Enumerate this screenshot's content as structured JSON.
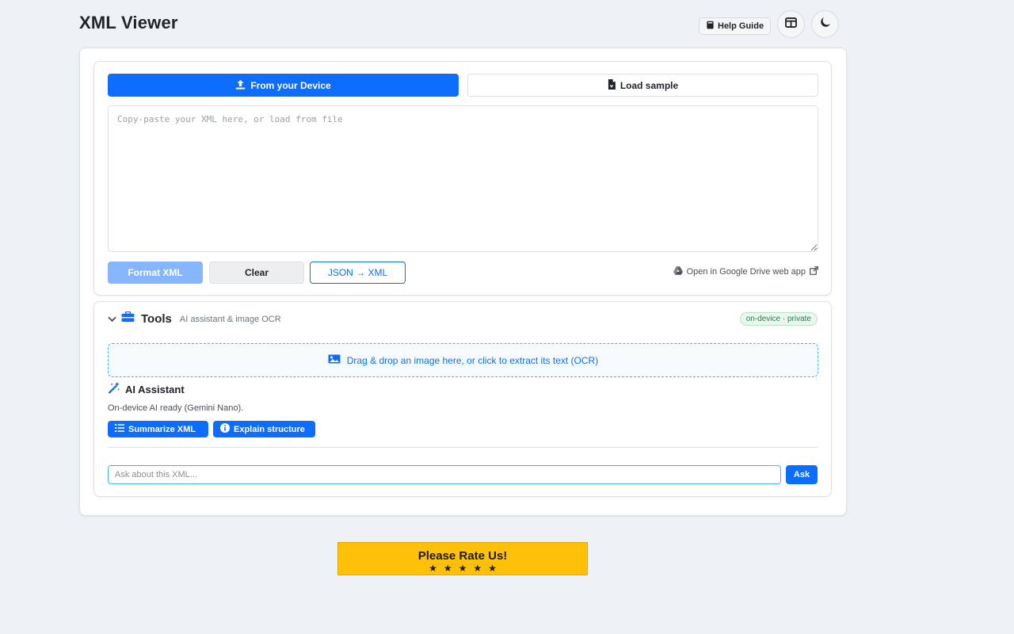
{
  "header": {
    "title": "XML Viewer",
    "help_label": "Help Guide"
  },
  "editor": {
    "tab_device": "From your Device",
    "tab_sample": "Load sample",
    "textarea_placeholder": "Copy-paste your XML here, or load from file",
    "textarea_value": "",
    "format_label": "Format XML",
    "clear_label": "Clear",
    "json_label": "JSON → XML",
    "drive_label": "Open in Google Drive web app"
  },
  "tools": {
    "title": "Tools",
    "subtitle": "AI assistant & image OCR",
    "badge": "on-device · private",
    "dropzone_text": "Drag & drop an image here, or click to extract its text (OCR)",
    "ai_title": "AI Assistant",
    "ai_status": "On-device AI ready (Gemini Nano).",
    "summarize_label": "Summarize XML",
    "explain_label": "Explain structure",
    "ask_placeholder": "Ask about this XML...",
    "ask_value": "",
    "ask_button": "Ask"
  },
  "rate": {
    "label": "Please Rate Us!",
    "stars": "★★★★★"
  },
  "colors": {
    "primary": "#0d6efd",
    "primary_light": "#86b6fe",
    "rate_yellow": "#ffc107",
    "background": "#eef1f5"
  },
  "icons": [
    "book-icon",
    "layout-icon",
    "moon-icon",
    "upload-icon",
    "file-icon",
    "google-drive-icon",
    "external-link-icon",
    "chevron-down-icon",
    "toolbox-icon",
    "image-icon",
    "magic-wand-icon",
    "list-icon",
    "info-icon"
  ]
}
